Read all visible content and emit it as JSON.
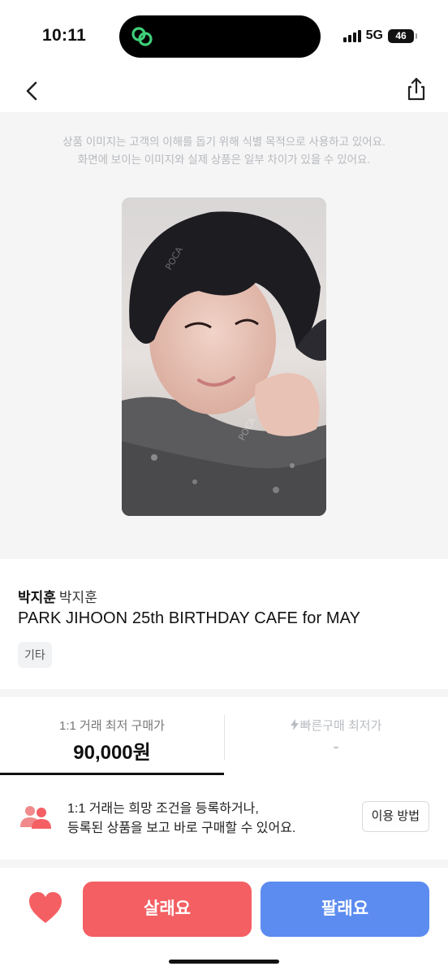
{
  "status_bar": {
    "time": "10:11",
    "network": "5G",
    "battery": "46"
  },
  "nav": {
    "back_icon": "chevron-left-icon",
    "share_icon": "share-icon"
  },
  "image_notice": {
    "line1": "상품 이미지는 고객의 이해를 돕기 위해 식별 목적으로 사용하고 있어요.",
    "line2": "화면에 보이는 이미지와 실제 상품은 일부 차이가 있을 수 있어요."
  },
  "product": {
    "artist_bold": "박지훈",
    "artist_name": "박지훈",
    "title": "PARK JIHOON 25th BIRTHDAY CAFE for MAY",
    "tag": "기타"
  },
  "price_tabs": [
    {
      "label": "1:1 거래 최저 구매가",
      "value": "90,000원"
    },
    {
      "label": "빠른구매 최저가",
      "value": "-"
    }
  ],
  "guide": {
    "line1": "1:1 거래는 희망 조건을 등록하거나,",
    "line2": "등록된 상품을 보고 바로 구매할 수 있어요.",
    "button": "이용 방법"
  },
  "actions": {
    "buy": "살래요",
    "sell": "팔래요"
  },
  "colors": {
    "buy": "#f45f63",
    "sell": "#5c8cf0",
    "accent_green": "#3fd07a",
    "heart": "#f45f63"
  }
}
